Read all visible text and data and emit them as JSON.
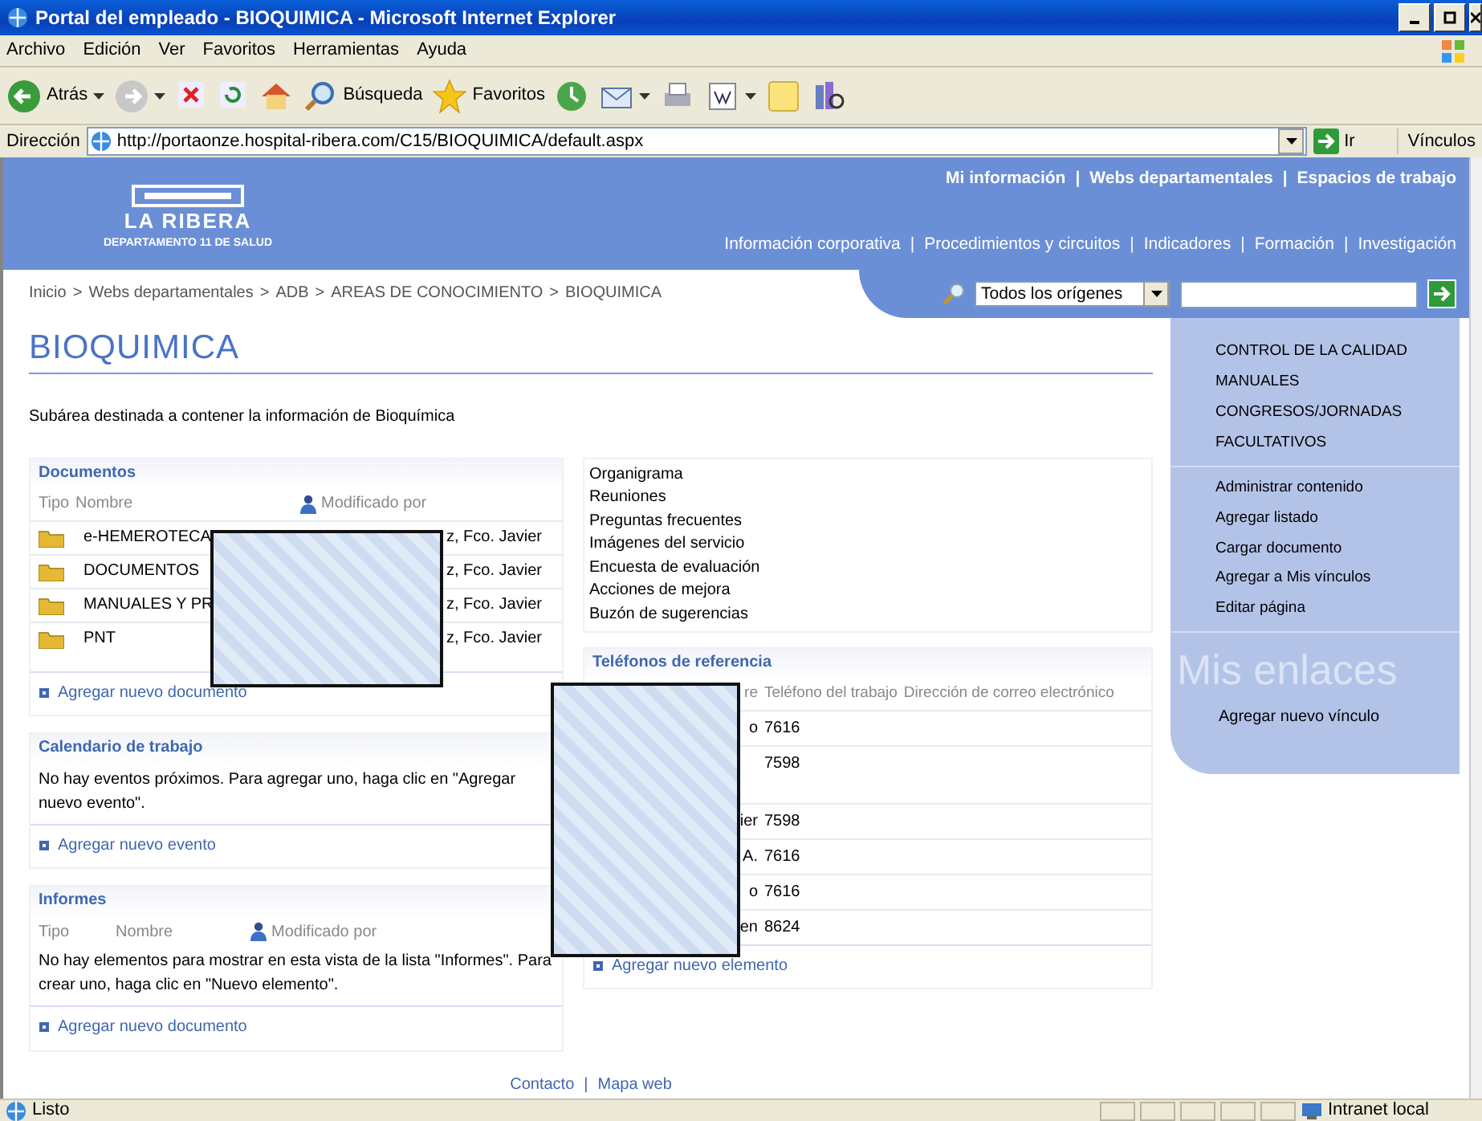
{
  "window": {
    "title": "Portal del empleado - BIOQUIMICA - Microsoft Internet Explorer"
  },
  "menu": [
    "Archivo",
    "Edición",
    "Ver",
    "Favoritos",
    "Herramientas",
    "Ayuda"
  ],
  "toolbar": [
    {
      "kind": "back",
      "label": "Atrás"
    },
    {
      "kind": "forward"
    },
    {
      "kind": "stop"
    },
    {
      "kind": "refresh"
    },
    {
      "kind": "home"
    },
    {
      "kind": "search",
      "label": "Búsqueda"
    },
    {
      "kind": "favorites",
      "label": "Favoritos"
    },
    {
      "kind": "history"
    },
    {
      "kind": "mail"
    },
    {
      "kind": "print"
    },
    {
      "kind": "edit"
    },
    {
      "kind": "note"
    },
    {
      "kind": "research"
    }
  ],
  "address": {
    "label": "Dirección",
    "url": "http://portaonze.hospital-ribera.com/C15/BIOQUIMICA/default.aspx",
    "go": "Ir",
    "links": "Vínculos"
  },
  "site": {
    "logo_title": "LA RIBERA",
    "logo_subtitle": "DEPARTAMENTO 11 DE SALUD",
    "top_links": [
      "Mi información",
      "Webs departamentales",
      "Espacios de trabajo"
    ],
    "nav": [
      "Información corporativa",
      "Procedimientos y circuitos",
      "Indicadores",
      "Formación",
      "Investigación"
    ],
    "breadcrumb": [
      "Inicio",
      "Webs departamentales",
      "ADB",
      "AREAS DE CONOCIMIENTO",
      "BIOQUIMICA"
    ],
    "separator": ">",
    "link_separator": "|",
    "search_scope": "Todos los orígenes"
  },
  "page": {
    "title": "BIOQUIMICA",
    "description": "Subárea destinada a contener la información de Bioquímica"
  },
  "documents": {
    "title": "Documentos",
    "columns": [
      "Tipo",
      "Nombre",
      "Modificado por"
    ],
    "rows": [
      {
        "name": "e-HEMEROTECA",
        "modified_by": "z, Fco. Javier"
      },
      {
        "name": "DOCUMENTOS",
        "modified_by": "z, Fco. Javier"
      },
      {
        "name": "MANUALES Y PR",
        "modified_by": "z, Fco. Javier"
      },
      {
        "name": "PNT",
        "modified_by": "z, Fco. Javier"
      }
    ],
    "add_link": "Agregar nuevo documento"
  },
  "calendar": {
    "title": "Calendario de trabajo",
    "message": "No hay eventos próximos. Para agregar uno, haga clic en \"Agregar nuevo evento\".",
    "add_link": "Agregar nuevo evento"
  },
  "reports": {
    "title": "Informes",
    "columns": [
      "Tipo",
      "Nombre",
      "Modificado por"
    ],
    "message": "No hay elementos para mostrar en esta vista de la lista \"Informes\". Para crear uno, haga clic en \"Nuevo elemento\".",
    "add_link": "Agregar nuevo documento"
  },
  "quick_links": [
    "Organigrama",
    "Reuniones",
    "Preguntas frecuentes",
    "Imágenes del servicio",
    "Encuesta de evaluación",
    "Acciones de mejora",
    "Buzón de sugerencias"
  ],
  "phones": {
    "title": "Teléfonos de referencia",
    "columns": [
      "re",
      "Teléfono del trabajo",
      "Dirección de correo electrónico"
    ],
    "rows": [
      {
        "name": "o",
        "phone": "7616"
      },
      {
        "phone": "7598"
      },
      {
        "name": "ier",
        "phone": "7598"
      },
      {
        "name": "A.",
        "phone": "7616"
      },
      {
        "name": "o",
        "phone": "7616"
      },
      {
        "name": "en",
        "phone": "8624"
      }
    ],
    "add_link": "Agregar nuevo elemento"
  },
  "sidebar": {
    "areas": [
      "CONTROL DE LA CALIDAD",
      "MANUALES",
      "CONGRESOS/JORNADAS",
      "FACULTATIVOS"
    ],
    "actions": [
      "Administrar contenido",
      "Agregar listado",
      "Cargar documento",
      "Agregar a Mis vínculos",
      "Editar página"
    ],
    "links_title": "Mis enlaces",
    "add_link": "Agregar nuevo vínculo"
  },
  "footer": [
    "Contacto",
    "Mapa web"
  ],
  "status_bar": {
    "text": "Listo",
    "zone": "Intranet local"
  }
}
